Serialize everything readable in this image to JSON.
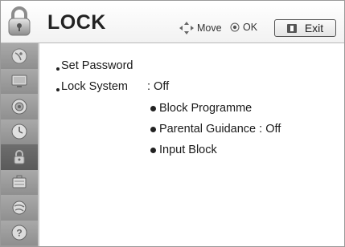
{
  "header": {
    "title": "LOCK",
    "move_label": "Move",
    "ok_label": "OK",
    "exit_label": "Exit"
  },
  "sidebar": {
    "items": [
      {
        "name": "satellite-icon"
      },
      {
        "name": "picture-icon"
      },
      {
        "name": "audio-icon"
      },
      {
        "name": "clock-icon"
      },
      {
        "name": "lock-icon",
        "active": true
      },
      {
        "name": "option-icon"
      },
      {
        "name": "network-icon"
      },
      {
        "name": "help-icon"
      }
    ]
  },
  "menu": {
    "set_password": "Set Password",
    "lock_system_label": "Lock System",
    "lock_system_value": ": Off",
    "block_programme": "Block Programme",
    "parental_guidance": "Parental Guidance : Off",
    "input_block": "Input Block"
  }
}
